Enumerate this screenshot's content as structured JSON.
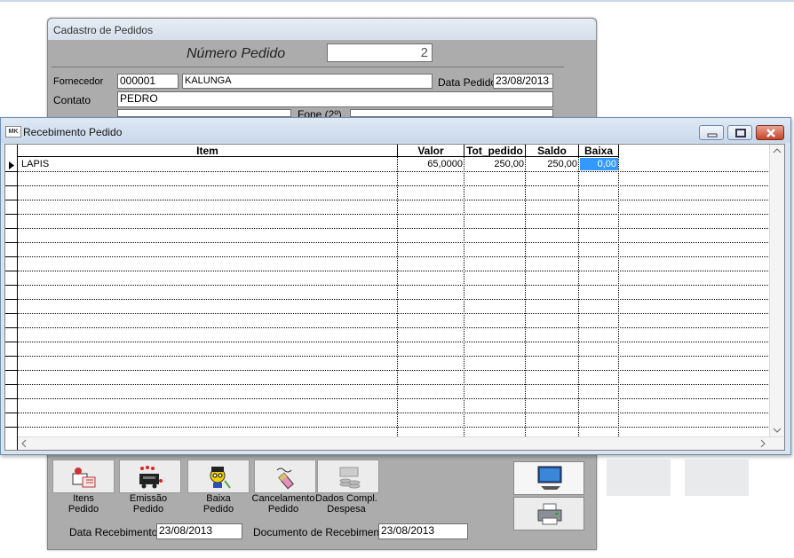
{
  "back_window": {
    "title": "Cadastro de Pedidos",
    "numero_pedido_label": "Número Pedido",
    "numero_pedido_value": "2",
    "fornecedor_label": "Fornecedor",
    "fornecedor_code": "000001",
    "fornecedor_name": "KALUNGA",
    "data_pedido_label": "Data Pedido",
    "data_pedido_value": "23/08/2013",
    "contato_label": "Contato",
    "contato_value": "PEDRO",
    "fone_label": "Fone (2º)",
    "toolbar": [
      {
        "line1": "Itens",
        "line2": "Pedido",
        "icon": "items-icon"
      },
      {
        "line1": "Emissão",
        "line2": "Pedido",
        "icon": "printer-emission-icon"
      },
      {
        "line1": "Baixa",
        "line2": "Pedido",
        "icon": "worker-icon"
      },
      {
        "line1": "Cancelamento",
        "line2": "Pedido",
        "icon": "eraser-icon"
      },
      {
        "line1": "Dados Compl.",
        "line2": "Despesa",
        "icon": "coins-icon"
      }
    ],
    "data_recebimento_label": "Data Recebimento",
    "data_recebimento_value": "23/08/2013",
    "documento_label": "Documento de Recebimento",
    "documento_value": "23/08/2013"
  },
  "receiving_window": {
    "app_icon": "MK",
    "title": "Recebimento Pedido",
    "columns": [
      "Item",
      "Valor",
      "Tot_pedido",
      "Saldo",
      "Baixa"
    ],
    "rows": [
      {
        "item": "LAPIS",
        "valor": "65,0000",
        "tot_pedido": "250,00",
        "saldo": "250,00",
        "baixa": "0,00"
      }
    ]
  }
}
